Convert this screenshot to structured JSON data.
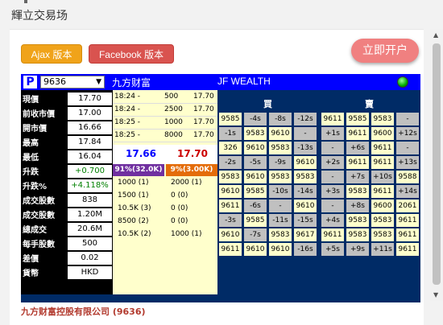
{
  "page": {
    "title": "輝立交易场"
  },
  "buttons": {
    "ajax": "Ajax 版本",
    "facebook": "Facebook 版本",
    "open_account": "立即开户"
  },
  "widget": {
    "code": "9636",
    "company": "九方财富",
    "brand": "JF WEALTH",
    "left_rows": [
      {
        "label": "現價",
        "value": "17.70"
      },
      {
        "label": "前收市價",
        "value": "17.00"
      },
      {
        "label": "開市價",
        "value": "16.66"
      },
      {
        "label": "最高",
        "value": "17.84"
      },
      {
        "label": "最低",
        "value": "16.04"
      },
      {
        "label": "升跌",
        "value": "+0.700",
        "color": "#008000"
      },
      {
        "label": "升跌%",
        "value": "+4.118%",
        "color": "#008000"
      },
      {
        "label": "成交股數",
        "value": "838"
      },
      {
        "label": "成交股數",
        "value": "1.20M"
      },
      {
        "label": "總成交",
        "value": "20.6M"
      },
      {
        "label": "每手股數",
        "value": "500"
      },
      {
        "label": "差價",
        "value": "0.02"
      },
      {
        "label": "貨幣",
        "value": "HKD"
      }
    ],
    "trades": [
      {
        "time": "18:24 -",
        "qty": "500",
        "price": "17.70"
      },
      {
        "time": "18:24 -",
        "qty": "2500",
        "price": "17.70"
      },
      {
        "time": "18:25 -",
        "qty": "1000",
        "price": "17.70"
      },
      {
        "time": "18:25 -",
        "qty": "8000",
        "price": "17.70"
      }
    ],
    "bid_price": "17.66",
    "ask_price": "17.70",
    "bid_pct": "91%(32.0K)",
    "ask_pct": "9%(3.00K)",
    "queue": [
      {
        "bid": "1000 (1)",
        "ask": "2000 (1)"
      },
      {
        "bid": "1500 (1)",
        "ask": "0 (0)"
      },
      {
        "bid": "10.5K (3)",
        "ask": "0 (0)"
      },
      {
        "bid": "8500 (2)",
        "ask": "0 (0)"
      },
      {
        "bid": "10.5K (2)",
        "ask": "1000 (1)"
      }
    ],
    "buy_label": "買",
    "sell_label": "賣",
    "broker_grid": [
      [
        "9585",
        "-4s",
        "-8s",
        "-12s",
        "9611",
        "9585",
        "9583",
        "-"
      ],
      [
        "-1s",
        "9583",
        "9610",
        "-",
        "+1s",
        "9611",
        "9600",
        "+12s"
      ],
      [
        "326",
        "9610",
        "9583",
        "-13s",
        "-",
        "+6s",
        "9611",
        "-"
      ],
      [
        "-2s",
        "-5s",
        "-9s",
        "9610",
        "+2s",
        "9611",
        "9611",
        "+13s"
      ],
      [
        "9583",
        "9610",
        "9583",
        "9583",
        "-",
        "+7s",
        "+10s",
        "9588"
      ],
      [
        "9610",
        "9585",
        "-10s",
        "-14s",
        "+3s",
        "9583",
        "9611",
        "+14s"
      ],
      [
        "9611",
        "-6s",
        "-",
        "9610",
        "-",
        "+8s",
        "9600",
        "2061"
      ],
      [
        "-3s",
        "9585",
        "-11s",
        "-15s",
        "+4s",
        "9583",
        "9583",
        "9611"
      ],
      [
        "9610",
        "-7s",
        "9583",
        "9617",
        "9611",
        "9583",
        "9583",
        "9611"
      ],
      [
        "9611",
        "9610",
        "9610",
        "-16s",
        "+5s",
        "+9s",
        "+11s",
        "9611"
      ]
    ]
  },
  "footer": {
    "company_line": "九方财富控股有限公司 (9636)"
  },
  "colors": {
    "header_blue": "#0000ff",
    "panel_navy": "#002b66",
    "bid_purple": "#7030a0",
    "ask_orange": "#e46c0a",
    "bid_price": "#0000ff",
    "ask_price": "#cc0000"
  }
}
